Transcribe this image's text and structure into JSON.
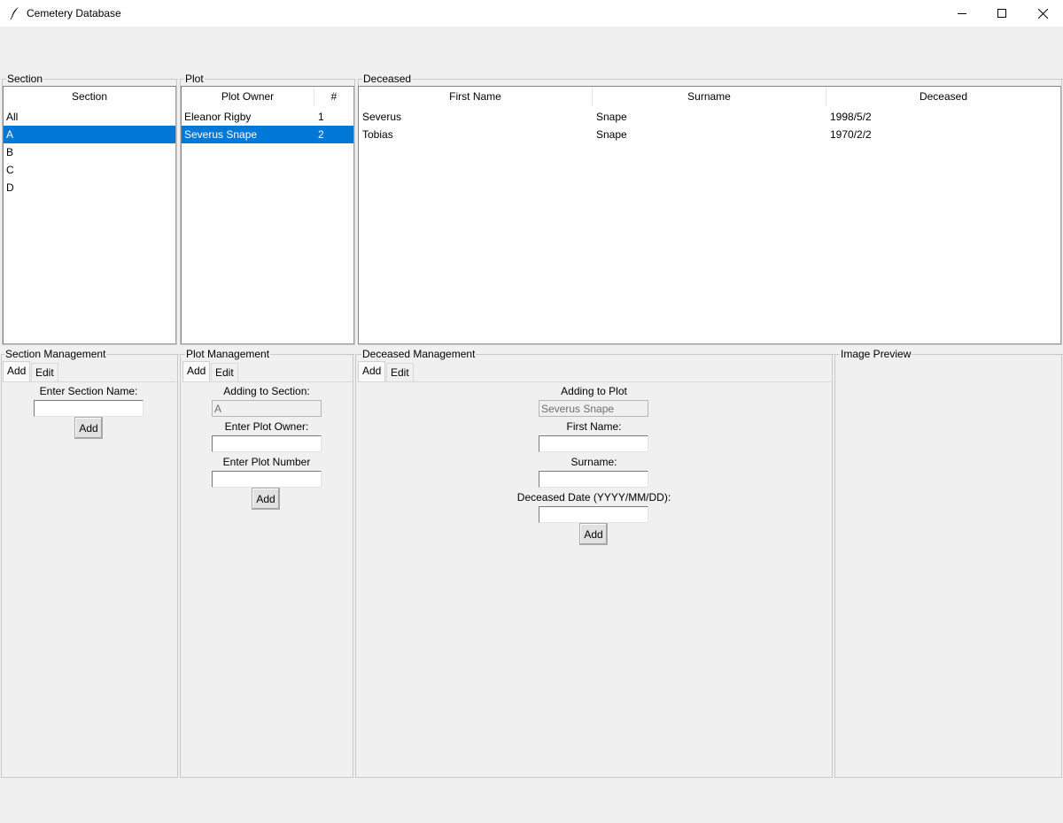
{
  "window": {
    "title": "Cemetery Database"
  },
  "section_frame": {
    "title": "Section",
    "header": "Section",
    "items": [
      "All",
      "A",
      "B",
      "C",
      "D"
    ],
    "selected_index": 1
  },
  "plot_frame": {
    "title": "Plot",
    "headers": [
      "Plot Owner",
      "#"
    ],
    "rows": [
      {
        "owner": "Eleanor Rigby",
        "number": "1"
      },
      {
        "owner": "Severus Snape",
        "number": "2"
      }
    ],
    "selected_index": 1
  },
  "deceased_frame": {
    "title": "Deceased",
    "headers": [
      "First Name",
      "Surname",
      "Deceased"
    ],
    "rows": [
      {
        "first": "Severus",
        "surname": "Snape",
        "date": "1998/5/2"
      },
      {
        "first": "Tobias",
        "surname": "Snape",
        "date": "1970/2/2"
      }
    ]
  },
  "section_mgmt": {
    "title": "Section Management",
    "tabs": [
      "Add",
      "Edit"
    ],
    "label": "Enter Section Name:",
    "value": "",
    "button": "Add"
  },
  "plot_mgmt": {
    "title": "Plot Management",
    "tabs": [
      "Add",
      "Edit"
    ],
    "section_label": "Adding to Section:",
    "section_value": "A",
    "owner_label": "Enter Plot Owner:",
    "owner_value": "",
    "number_label": "Enter Plot Number",
    "number_value": "",
    "button": "Add"
  },
  "deceased_mgmt": {
    "title": "Deceased Management",
    "tabs": [
      "Add",
      "Edit"
    ],
    "plot_label": "Adding to Plot",
    "plot_value": "Severus Snape",
    "first_label": "First Name:",
    "first_value": "",
    "surname_label": "Surname:",
    "surname_value": "",
    "date_label": "Deceased Date (YYYY/MM/DD):",
    "date_value": "",
    "button": "Add"
  },
  "image_preview": {
    "title": "Image Preview"
  },
  "icons": {
    "app": "feather-icon",
    "minimize": "minimize-icon",
    "maximize": "maximize-icon",
    "close": "close-icon"
  },
  "colors": {
    "selection": "#0078d7",
    "background": "#f0f0f0"
  }
}
